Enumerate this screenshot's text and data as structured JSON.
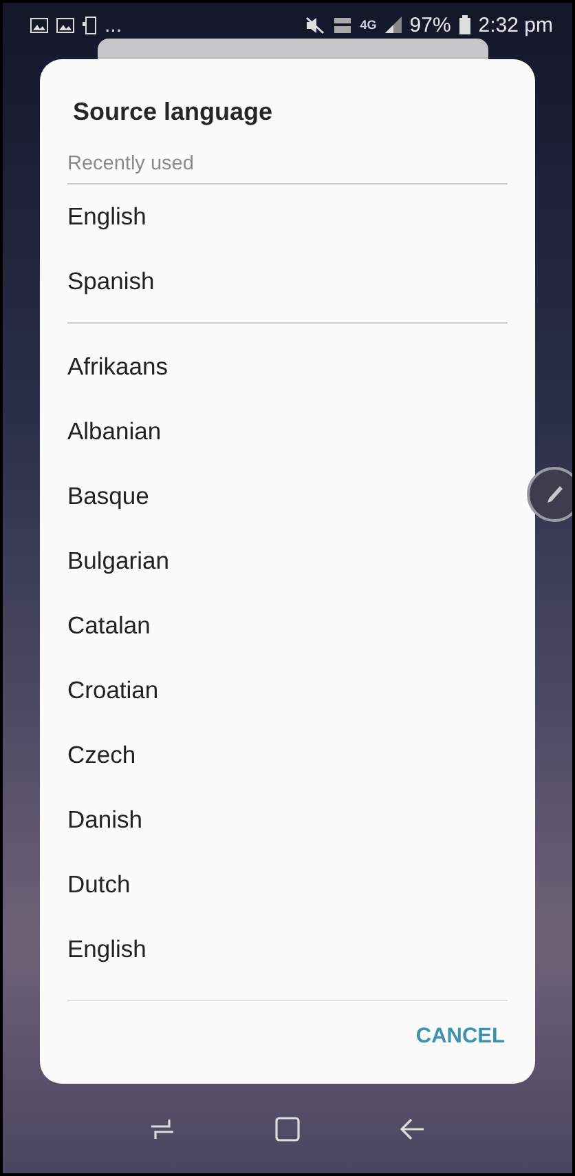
{
  "status_bar": {
    "more": "...",
    "network": "4G",
    "battery": "97%",
    "time": "2:32 pm"
  },
  "dialog": {
    "title": "Source language",
    "recent_header": "Recently used",
    "recent": [
      "English",
      "Spanish"
    ],
    "languages": [
      "Afrikaans",
      "Albanian",
      "Basque",
      "Bulgarian",
      "Catalan",
      "Croatian",
      "Czech",
      "Danish",
      "Dutch",
      "English"
    ],
    "cancel": "CANCEL"
  }
}
